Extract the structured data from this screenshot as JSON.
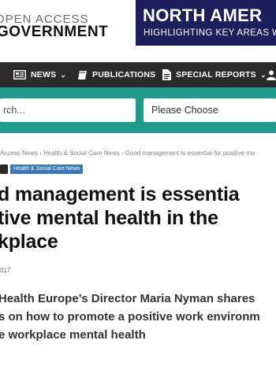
{
  "header": {
    "logo_top": "OPEN ACCESS",
    "logo_bottom": "GOVERNMENT",
    "banner_title": "NORTH AMER",
    "banner_subtitle": "HIGHLIGHTING KEY AREAS W"
  },
  "nav": {
    "items": [
      {
        "label": "NEWS",
        "icon": "newspaper-icon",
        "has_dropdown": true
      },
      {
        "label": "PUBLICATIONS",
        "icon": "book-icon",
        "has_dropdown": false
      },
      {
        "label": "SPECIAL REPORTS",
        "icon": "document-icon",
        "has_dropdown": true
      }
    ]
  },
  "search": {
    "placeholder": "rch...",
    "select_value": "Please Choose"
  },
  "breadcrumb": {
    "items": [
      "Access News",
      "Health & Social Care News",
      "Good management is essential for positive me"
    ],
    "separator": "›"
  },
  "tags": [
    "",
    "Health & Social Care News"
  ],
  "article": {
    "title_lines": [
      "d management is essentia",
      "tive mental health in the",
      "kplace"
    ],
    "date": "017",
    "subtitle_lines": [
      "Health Europe’s Director Maria Nyman shares",
      "s on how to promote a positive work environm",
      "e workplace mental health"
    ]
  },
  "colors": {
    "nav_bg": "#2b2b2b",
    "search_band": "#1e9b8b",
    "banner_bg": "#1b1f5c",
    "tag_blue": "#3b78b8"
  }
}
